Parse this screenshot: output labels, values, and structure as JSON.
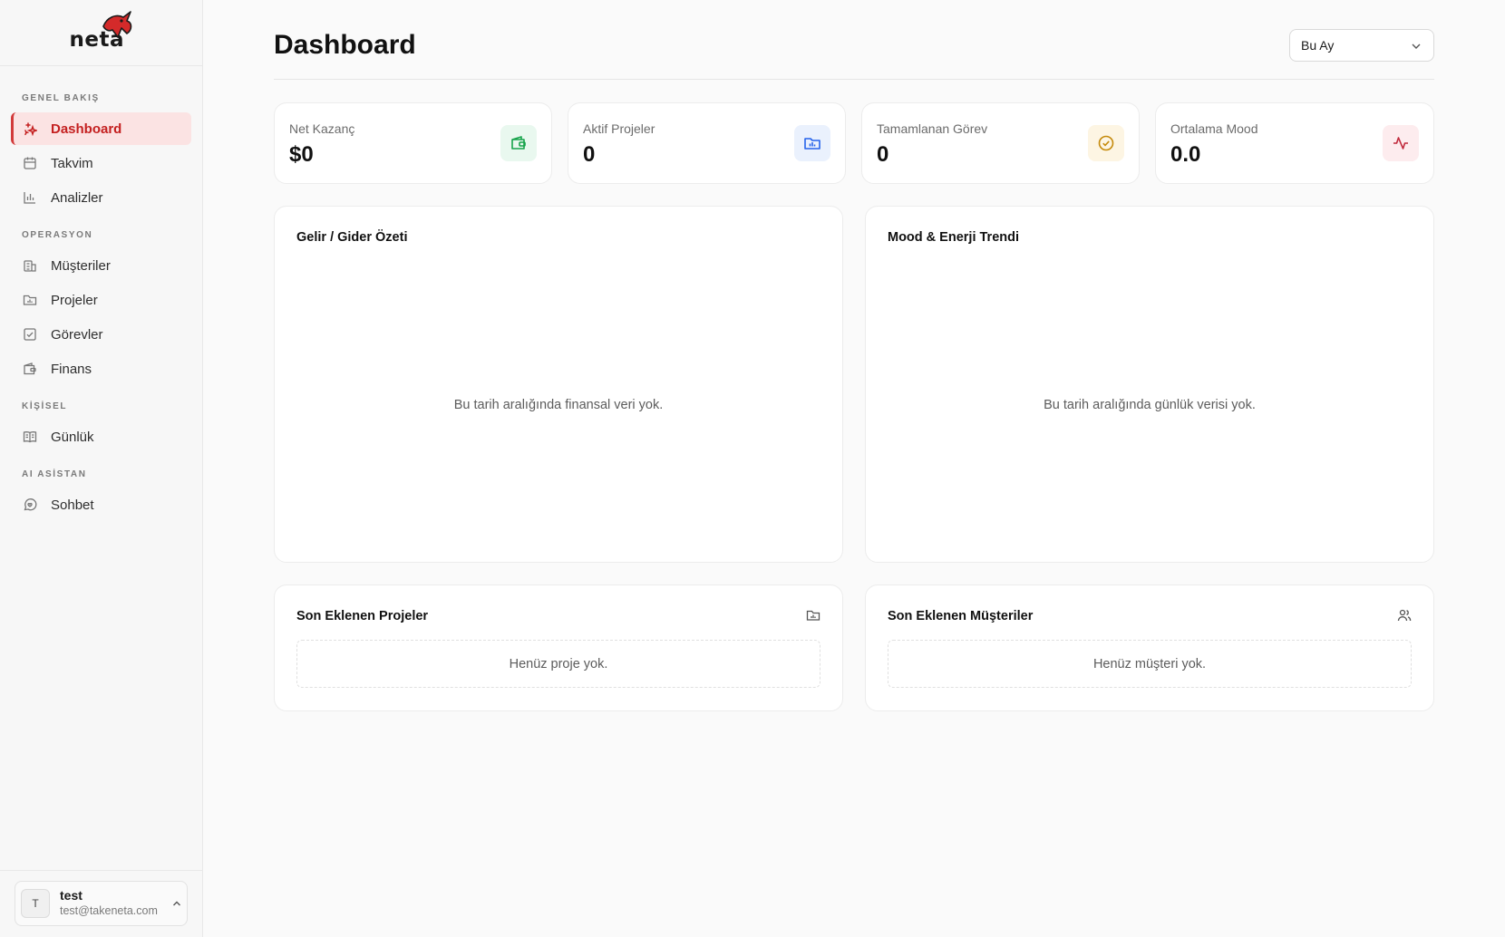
{
  "brand": {
    "name": "neta",
    "accent": "#d42a2a"
  },
  "sidebar": {
    "sections": [
      {
        "label": "GENEL BAKIŞ"
      },
      {
        "label": "OPERASYON"
      },
      {
        "label": "KİŞİSEL"
      },
      {
        "label": "AI ASİSTAN"
      }
    ],
    "items": [
      {
        "label": "Dashboard",
        "icon": "sparkle-icon",
        "active": true
      },
      {
        "label": "Takvim",
        "icon": "calendar-icon"
      },
      {
        "label": "Analizler",
        "icon": "bar-chart-icon"
      },
      {
        "label": "Müşteriler",
        "icon": "building-icon"
      },
      {
        "label": "Projeler",
        "icon": "folder-icon"
      },
      {
        "label": "Görevler",
        "icon": "check-square-icon"
      },
      {
        "label": "Finans",
        "icon": "wallet-icon"
      },
      {
        "label": "Günlük",
        "icon": "book-icon"
      },
      {
        "label": "Sohbet",
        "icon": "chat-icon"
      }
    ],
    "user": {
      "initial": "T",
      "name": "test",
      "email": "test@takeneta.com"
    }
  },
  "header": {
    "title": "Dashboard",
    "period": "Bu Ay"
  },
  "stats": [
    {
      "label": "Net Kazanç",
      "value": "$0",
      "icon": "wallet-icon",
      "color": "#16a34a",
      "bg": "#e9f8ef"
    },
    {
      "label": "Aktif Projeler",
      "value": "0",
      "icon": "folder-chart-icon",
      "color": "#2563eb",
      "bg": "#eaf1fd"
    },
    {
      "label": "Tamamlanan Görev",
      "value": "0",
      "icon": "check-circle-icon",
      "color": "#c58a0b",
      "bg": "#fdf5e3"
    },
    {
      "label": "Ortalama Mood",
      "value": "0.0",
      "icon": "activity-icon",
      "color": "#c0283b",
      "bg": "#fdecee"
    }
  ],
  "panels": {
    "income": {
      "title": "Gelir / Gider Özeti",
      "empty": "Bu tarih aralığında finansal veri yok."
    },
    "mood": {
      "title": "Mood & Enerji Trendi",
      "empty": "Bu tarih aralığında günlük verisi yok."
    },
    "projects": {
      "title": "Son Eklenen Projeler",
      "empty": "Henüz proje yok."
    },
    "clients": {
      "title": "Son Eklenen Müşteriler",
      "empty": "Henüz müşteri yok."
    }
  }
}
